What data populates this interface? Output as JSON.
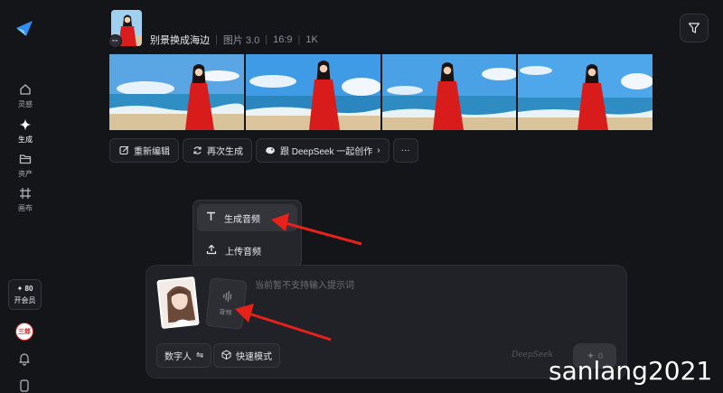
{
  "nav": {
    "items": [
      {
        "label": "灵感",
        "icon": "home-icon"
      },
      {
        "label": "生成",
        "icon": "sparkle-icon"
      },
      {
        "label": "资产",
        "icon": "folder-icon"
      },
      {
        "label": "画布",
        "icon": "canvas-icon"
      }
    ],
    "active": "生成"
  },
  "vip": {
    "points": "✦ 80",
    "label": "开会员"
  },
  "avatar": {
    "text": "三郎"
  },
  "result": {
    "badge": "👓",
    "title": "别景换成海边",
    "model": "图片 3.0",
    "ratio": "16:9",
    "resolution": "1K",
    "image_count": 4
  },
  "actions": [
    {
      "label": "重新编辑",
      "icon": "edit-icon"
    },
    {
      "label": "再次生成",
      "icon": "refresh-icon"
    },
    {
      "label": "跟 DeepSeek 一起创作",
      "icon": "deepseek-icon",
      "suffix": "›"
    },
    {
      "label": "···",
      "icon": "more-icon"
    }
  ],
  "menu": {
    "items": [
      {
        "label": "生成音频",
        "icon": "text-t-icon"
      },
      {
        "label": "上传音频",
        "icon": "upload-icon"
      }
    ],
    "highlighted": "生成音频"
  },
  "composer": {
    "audio_label": "音频",
    "placeholder": "当前暂不支持输入提示词",
    "digital_human_label": "数字人",
    "digital_human_suffix": "⇋",
    "fast_mode_label": "快速模式",
    "deepseek_mark": "DeepSeek",
    "send_cost": "0"
  },
  "watermark": "sanlang2021",
  "colors": {
    "background": "#141519",
    "panel": "#202227",
    "accent_red": "#e0201b",
    "logo_blue": "#2f8ff0"
  }
}
